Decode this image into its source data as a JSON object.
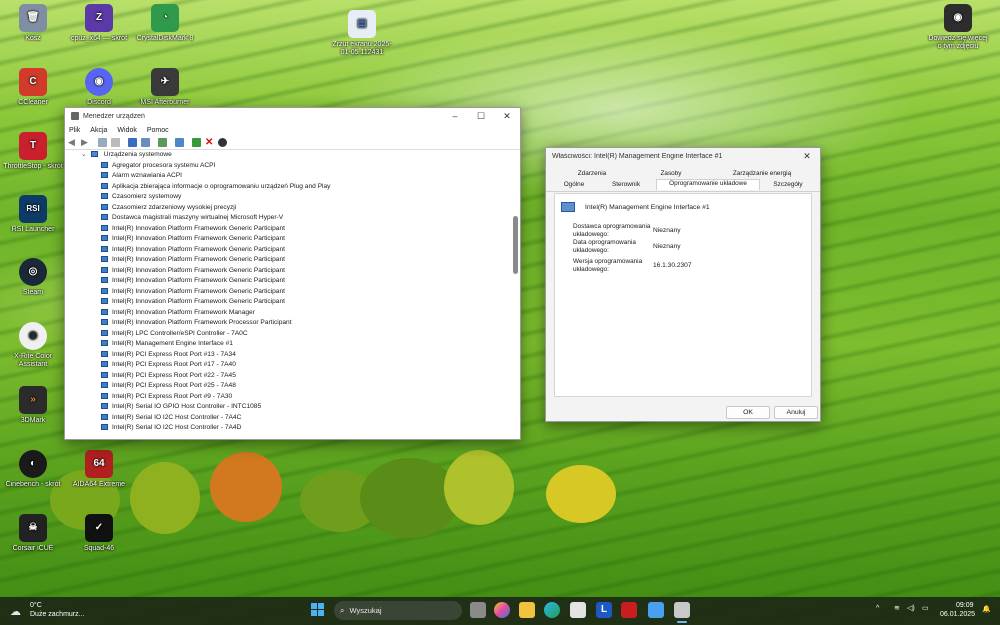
{
  "desktop": {
    "icons": [
      {
        "label": "Kosz",
        "color": "#7f8ea3",
        "glyph": "🗑"
      },
      {
        "label": "cpuz_x64 — skrót",
        "color": "#5b3aa8",
        "glyph": "Z"
      },
      {
        "label": "CrystalDiskMark 8",
        "color": "#2f9a4c",
        "glyph": "◔"
      },
      {
        "label": "CCleaner",
        "color": "#d23b2a",
        "glyph": "C"
      },
      {
        "label": "Discord",
        "color": "#5865f2",
        "glyph": "◉"
      },
      {
        "label": "MSI Afterburner",
        "color": "#3a3a3a",
        "glyph": "✈"
      },
      {
        "label": "ThrottleStop - skrót",
        "color": "#c8202c",
        "glyph": "T"
      },
      {
        "label": "RSI Launcher",
        "color": "#0d3b66",
        "glyph": "RSI"
      },
      {
        "label": "Steam",
        "color": "#1b2838",
        "glyph": "◎"
      },
      {
        "label": "X-Rite Color Assistant",
        "color": "#f0f0f0",
        "glyph": "◍"
      },
      {
        "label": "3DMark",
        "color": "#2b2b2b",
        "glyph": "»"
      },
      {
        "label": "Cinebench - skrót",
        "color": "#1a1a1a",
        "glyph": "◐"
      },
      {
        "label": "AIDA64 Extreme",
        "color": "#b02020",
        "glyph": "64"
      },
      {
        "label": "Corsair iCUE",
        "color": "#222222",
        "glyph": "☠"
      },
      {
        "label": "Squad-46",
        "color": "#111111",
        "glyph": "✓"
      },
      {
        "label": "Zrzut ekranu 2025-01-05 112431",
        "color": "#e8eef6",
        "glyph": "▤"
      },
      {
        "label": "Dowiedz się więcej o tym zdjęciu",
        "color": "#2d2d2d",
        "glyph": "◉"
      }
    ]
  },
  "devmgr": {
    "title": "Menedżer urządzeń",
    "menu": [
      "Plik",
      "Akcja",
      "Widok",
      "Pomoc"
    ],
    "category": "Urządzenia systemowe",
    "devices": [
      "Agregator procesora systemu ACPI",
      "Alarm wznawiania ACPI",
      "Aplikacja zbierająca informacje o oprogramowaniu urządzeń Plug and Play",
      "Czasomierz systemowy",
      "Czasomierz zdarzeniowy wysokiej precyzji",
      "Dostawca magistrali maszyny wirtualnej Microsoft Hyper-V",
      "Intel(R) Innovation Platform Framework Generic Participant",
      "Intel(R) Innovation Platform Framework Generic Participant",
      "Intel(R) Innovation Platform Framework Generic Participant",
      "Intel(R) Innovation Platform Framework Generic Participant",
      "Intel(R) Innovation Platform Framework Generic Participant",
      "Intel(R) Innovation Platform Framework Generic Participant",
      "Intel(R) Innovation Platform Framework Generic Participant",
      "Intel(R) Innovation Platform Framework Generic Participant",
      "Intel(R) Innovation Platform Framework Manager",
      "Intel(R) Innovation Platform Framework Processor Participant",
      "Intel(R) LPC Controller/eSPI Controller - 7A0C",
      "Intel(R) Management Engine Interface #1",
      "Intel(R) PCI Express Root Port #13 - 7A34",
      "Intel(R) PCI Express Root Port #17 - 7A40",
      "Intel(R) PCI Express Root Port #22 - 7A45",
      "Intel(R) PCI Express Root Port #25 - 7A48",
      "Intel(R) PCI Express Root Port #9 - 7A30",
      "Intel(R) Serial IO GPIO Host Controller - INTC1085",
      "Intel(R) Serial IO I2C Host Controller - 7A4C",
      "Intel(R) Serial IO I2C Host Controller - 7A4D"
    ]
  },
  "props": {
    "title": "Właściwości: Intel(R) Management Engine Interface #1",
    "tabs_row1": [
      "Zdarzenia",
      "Zasoby",
      "Zarządzanie energią"
    ],
    "tabs_row2": [
      "Ogólne",
      "Sterownik",
      "Oprogramowanie układowe",
      "Szczegóły"
    ],
    "device_name": "Intel(R) Management Engine Interface #1",
    "rows": [
      {
        "label": "Dostawca oprogramowania układowego:",
        "value": "Nieznany"
      },
      {
        "label": "Data oprogramowania układowego:",
        "value": "Nieznany"
      },
      {
        "label": "Wersja oprogramowania układowego:",
        "value": "16.1.30.2307"
      }
    ],
    "ok": "OK",
    "cancel": "Anuluj"
  },
  "taskbar": {
    "weather_temp": "0°C",
    "weather_desc": "Duże zachmurz...",
    "search_placeholder": "Wyszukaj",
    "time": "09:09",
    "date": "06.01.2025",
    "app_colors": [
      "#f4c23a",
      "#3a7bd5",
      "#2eb7e8",
      "#e3e3e3",
      "#1f57c4",
      "#c81e1e",
      "#4aa0ee",
      "#d0d0d0",
      "#6d6d6d"
    ]
  }
}
